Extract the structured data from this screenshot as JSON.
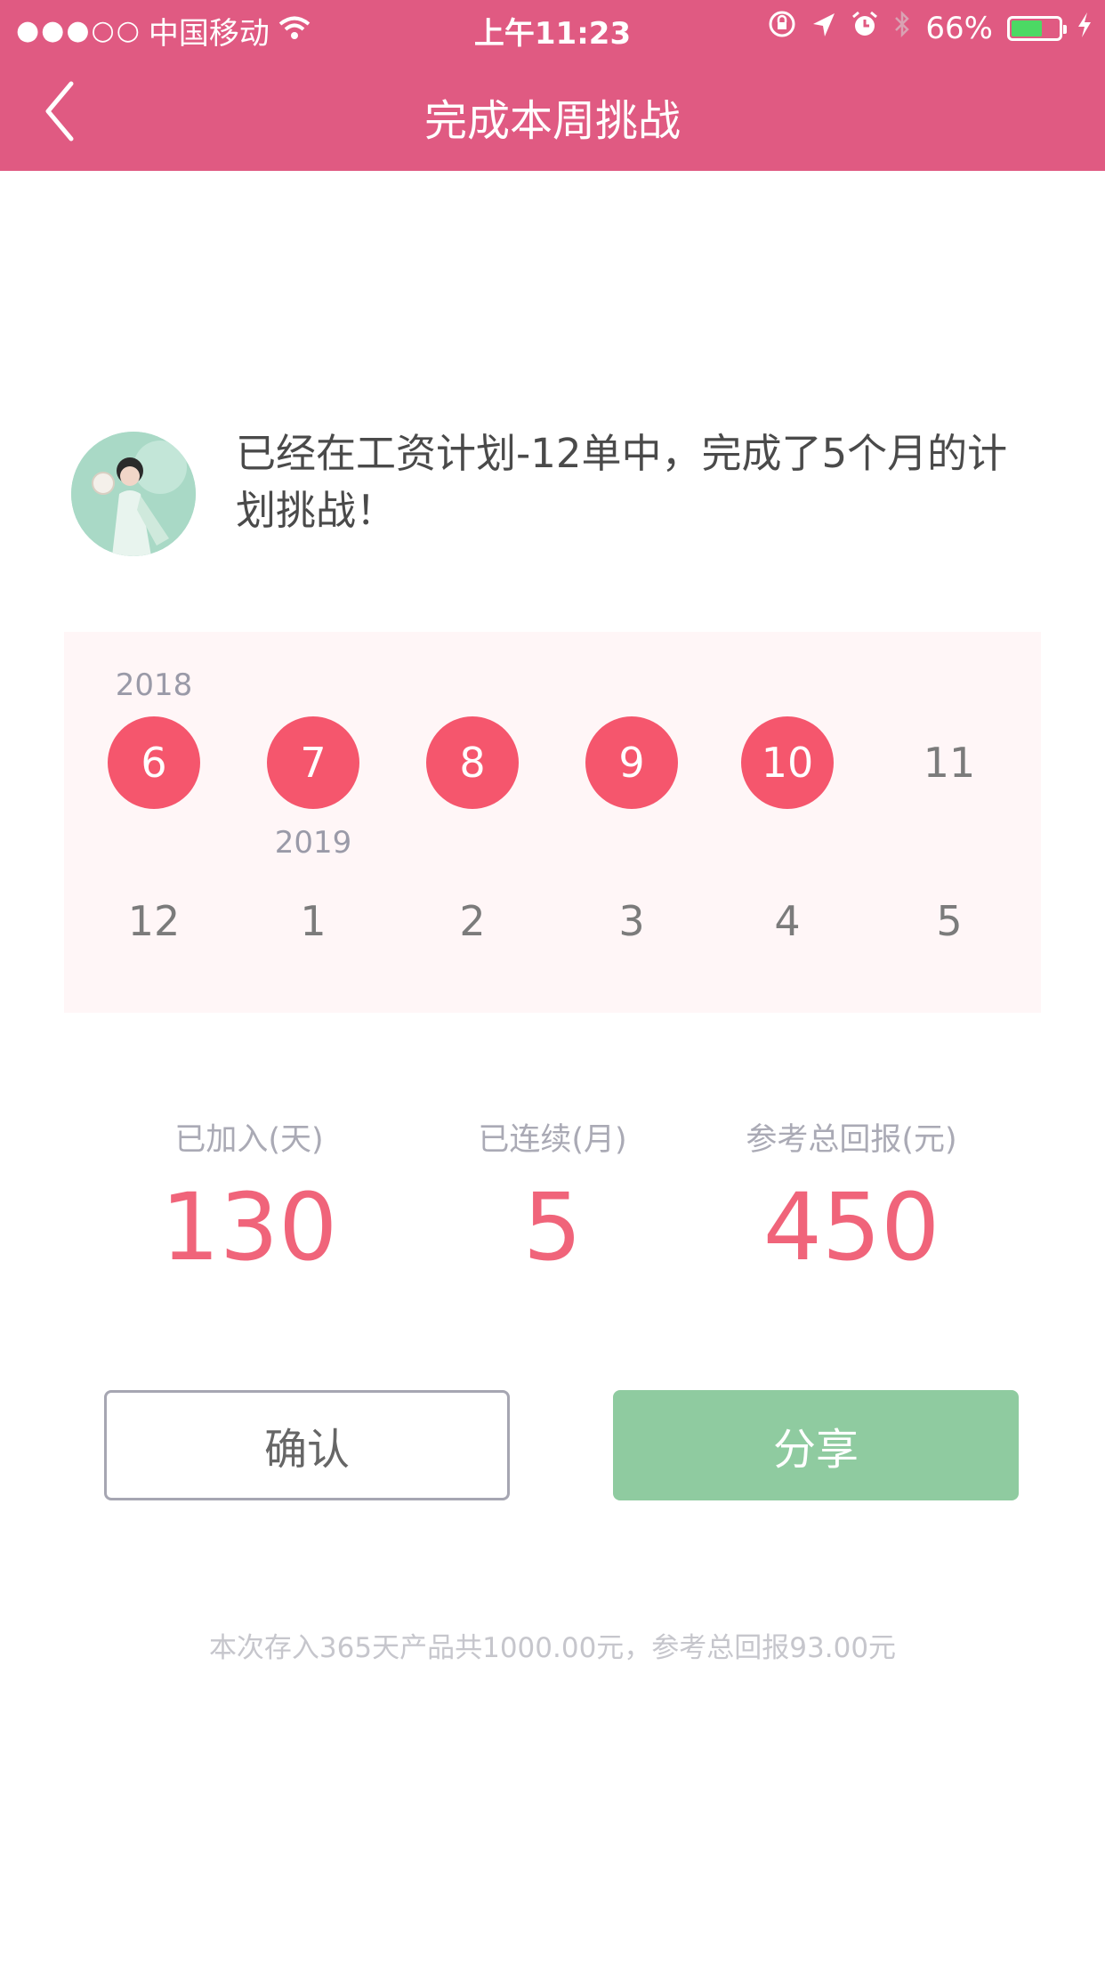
{
  "status_bar": {
    "signal": "●●●○○",
    "carrier": "中国移动",
    "time": "上午11:23",
    "battery": "66%",
    "battery_level": 0.66,
    "icons": [
      "wifi-icon",
      "rotation-lock-icon",
      "location-icon",
      "alarm-icon",
      "bluetooth-icon",
      "battery-icon",
      "charging-icon"
    ],
    "colors": {
      "battery_fill": "#4cd964"
    }
  },
  "header": {
    "title": "完成本周挑战",
    "back_icon": "chevron-left-icon",
    "background": "#e05a82"
  },
  "message": {
    "text": "已经在工资计划-12单中，完成了5个月的计划挑战！"
  },
  "calendar": {
    "year_labels": [
      "2018",
      "2019"
    ],
    "months": [
      {
        "label": "6",
        "completed": true
      },
      {
        "label": "7",
        "completed": true
      },
      {
        "label": "8",
        "completed": true
      },
      {
        "label": "9",
        "completed": true
      },
      {
        "label": "10",
        "completed": true
      },
      {
        "label": "11",
        "completed": false
      },
      {
        "label": "12",
        "completed": false
      },
      {
        "label": "1",
        "completed": false
      },
      {
        "label": "2",
        "completed": false
      },
      {
        "label": "3",
        "completed": false
      },
      {
        "label": "4",
        "completed": false
      },
      {
        "label": "5",
        "completed": false
      }
    ],
    "completed_color": "#f5566d"
  },
  "stats": [
    {
      "label": "已加入(天)",
      "value": "130"
    },
    {
      "label": "已连续(月)",
      "value": "5"
    },
    {
      "label": "参考总回报(元)",
      "value": "450"
    }
  ],
  "buttons": {
    "confirm": "确认",
    "share": "分享",
    "share_color": "#8fcba0"
  },
  "footnote": "本次存入365天产品共1000.00元，参考总回报93.00元"
}
